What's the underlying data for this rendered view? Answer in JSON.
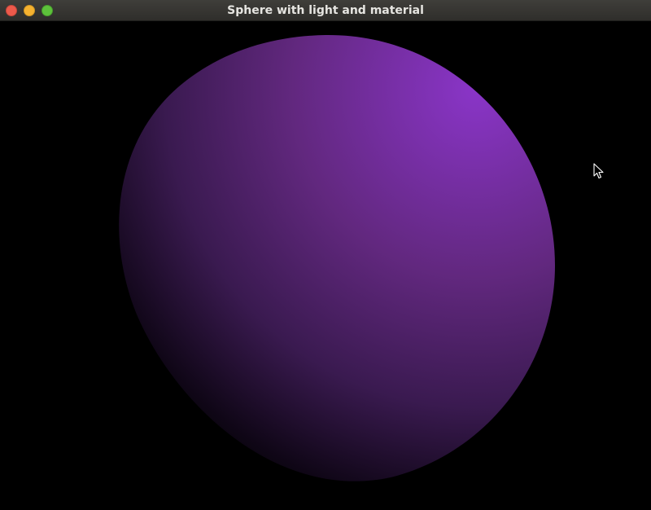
{
  "window": {
    "title": "Sphere with light and material"
  },
  "scene": {
    "object": "sphere",
    "material_color": "#7a2fb0",
    "light_color": "#8a35c8",
    "shadow_color": "#000000",
    "background_color": "#000000"
  },
  "icons": {
    "close": "close-icon",
    "minimize": "minimize-icon",
    "maximize": "maximize-icon",
    "cursor": "mouse-pointer-icon"
  }
}
